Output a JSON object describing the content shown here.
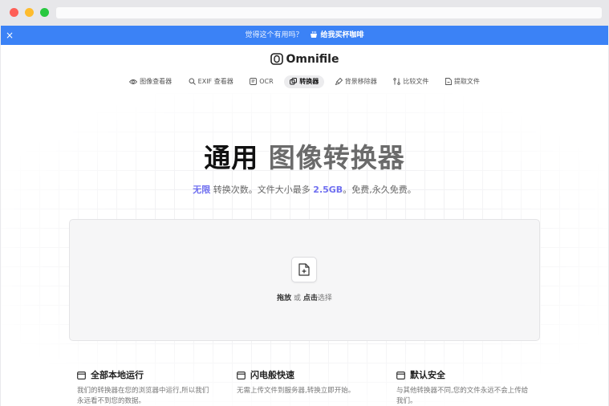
{
  "banner": {
    "close": "×",
    "question": "觉得这个有用吗？",
    "cup_icon": "coffee-cup-icon",
    "coffee_link": "给我买杯咖啡"
  },
  "header": {
    "brand": "Omnifile",
    "logo_icon": "omnifile-logo-icon"
  },
  "nav": [
    {
      "label": "图像查看器",
      "icon": "eye-icon",
      "active": false
    },
    {
      "label": "EXIF 查看器",
      "icon": "search-icon",
      "active": false
    },
    {
      "label": "OCR",
      "icon": "text-scan-icon",
      "active": false
    },
    {
      "label": "转换器",
      "icon": "convert-icon",
      "active": true
    },
    {
      "label": "背景移除器",
      "icon": "brush-icon",
      "active": false
    },
    {
      "label": "比较文件",
      "icon": "compare-icon",
      "active": false
    },
    {
      "label": "提取文件",
      "icon": "extract-file-icon",
      "active": false
    }
  ],
  "hero": {
    "title_part1": "通用",
    "title_part2": "图像转换器",
    "sub_highlight1": "无限",
    "sub_text1": " 转换次数。文件大小最多 ",
    "sub_highlight2": "2.5GB",
    "sub_text2": "。免费,永久免费。"
  },
  "dropzone": {
    "icon": "file-plus-icon",
    "drag": "拖放",
    "or": " 或 ",
    "click": "点击",
    "select": "选择"
  },
  "features": [
    {
      "title": "全部本地运行",
      "icon": "window-icon",
      "desc": "我们的转换器在您的浏览器中运行,所以我们永远看不到您的数据。"
    },
    {
      "title": "闪电般快速",
      "icon": "window-icon",
      "desc": "无需上传文件到服务器,转换立即开始。"
    },
    {
      "title": "默认安全",
      "icon": "window-icon",
      "desc": "与其他转换器不同,您的文件永远不会上传给我们。"
    }
  ],
  "colors": {
    "banner": "#3b82f6",
    "accent": "#6f6ff0"
  }
}
